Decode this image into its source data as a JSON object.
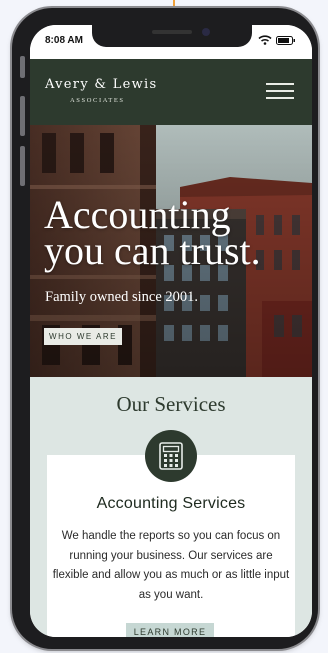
{
  "status_bar": {
    "time": "8:08 AM",
    "wifi_icon": "wifi-icon",
    "battery_icon": "battery-icon"
  },
  "header": {
    "brand_name": "Avery & Lewis",
    "brand_sub": "ASSOCIATES",
    "menu_icon": "hamburger-menu-icon",
    "colors": {
      "background": "#2d3a2e",
      "text": "#ffffff"
    }
  },
  "hero": {
    "title_line1": "Accounting",
    "title_line2": "you can trust.",
    "subtitle": "Family owned since 2001.",
    "cta_label": "WHO WE ARE"
  },
  "services": {
    "heading": "Our Services",
    "card": {
      "icon": "calculator-icon",
      "title": "Accounting Services",
      "description": "We handle the reports so you can focus on running your business. Our services are flexible and allow you as much or as little input as you want.",
      "cta_label": "LEARN MORE"
    },
    "colors": {
      "section_bg": "#dde6e3",
      "button_bg": "#c6d7d3"
    }
  }
}
